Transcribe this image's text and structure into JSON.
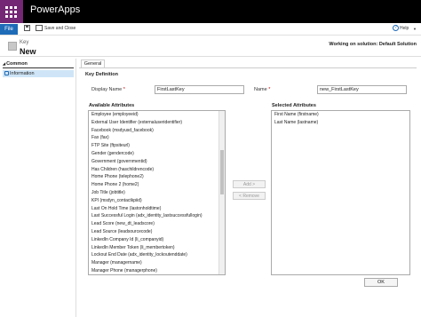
{
  "app": {
    "title": "PowerApps"
  },
  "toolbar": {
    "file_label": "File",
    "save_close_label": "Save and Close",
    "help_label": "Help"
  },
  "header": {
    "entity_type": "Key",
    "record_title": "New",
    "solution_text": "Working on solution: Default Solution"
  },
  "nav": {
    "section_label": "Common",
    "items": [
      {
        "label": "Information"
      }
    ]
  },
  "tabs": [
    {
      "label": "General"
    }
  ],
  "form": {
    "section_title": "Key Definition",
    "display_name_label": "Display Name",
    "display_name_value": "FirstLastKey",
    "name_label": "Name",
    "name_value": "new_FirstLastKey",
    "required_marker": "*"
  },
  "available": {
    "title": "Available Attributes",
    "items": [
      "Employee (employeeid)",
      "External User Identifier (externaluseridentifier)",
      "Facebook (msdyusd_facebook)",
      "Fax (fax)",
      "FTP Site (ftpsiteurl)",
      "Gender (gendercode)",
      "Government (governmentid)",
      "Has Children (haschildrencode)",
      "Home Phone (telephone2)",
      "Home Phone 2 (home2)",
      "Job Title (jobtitle)",
      "KPI (msdyn_contactkpiid)",
      "Last On Hold Time (lastonholdtime)",
      "Last Successful Login (adx_identity_lastsuccessfullogin)",
      "Lead Score (new_dt_leadscore)",
      "Lead Source (leadsourcecode)",
      "LinkedIn Company Id (li_companyid)",
      "LinkedIn Member Token (li_membertoken)",
      "Lockout End Date (adx_identity_lockoutenddate)",
      "Manager (managername)",
      "Manager Phone (managerphone)"
    ]
  },
  "selected": {
    "title": "Selected Attributes",
    "items": [
      "First Name (firstname)",
      "Last Name (lastname)"
    ]
  },
  "buttons": {
    "add_label": "Add >",
    "remove_label": "< Remove",
    "ok_label": "OK"
  },
  "colors": {
    "brand": "#742774",
    "topbar": "#000000",
    "file_button": "#1e6bb8",
    "nav_selected": "#cfe5f7"
  }
}
